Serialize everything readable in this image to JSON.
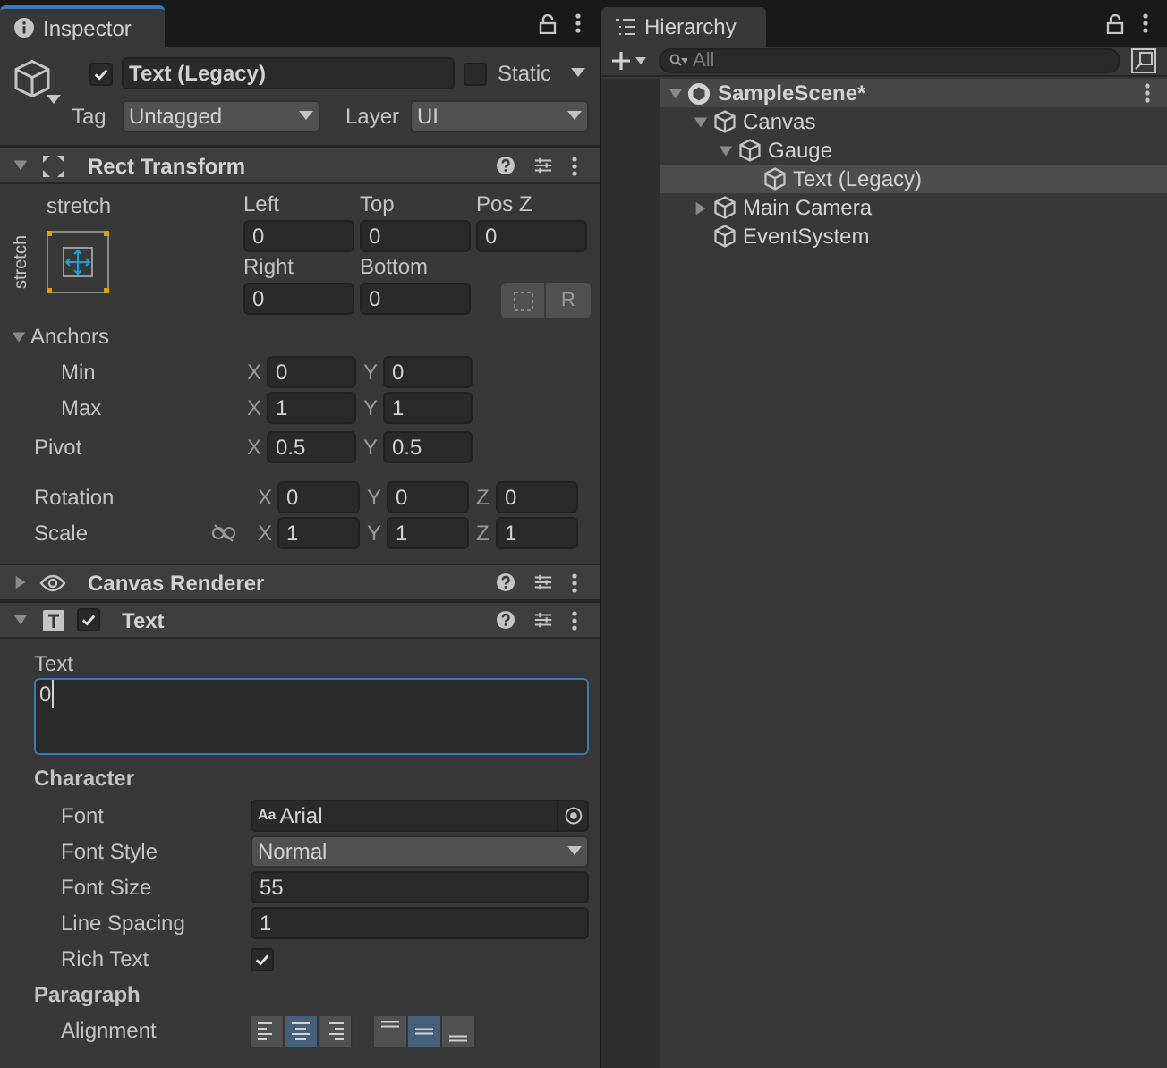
{
  "inspector": {
    "tab": "Inspector",
    "object": {
      "enabled": true,
      "name": "Text (Legacy)",
      "static_label": "Static",
      "static": false,
      "tag_label": "Tag",
      "tag": "Untagged",
      "layer_label": "Layer",
      "layer": "UI"
    },
    "rect_transform": {
      "title": "Rect Transform",
      "expanded": true,
      "anchor_h": "stretch",
      "anchor_v": "stretch",
      "row1": [
        {
          "label": "Left",
          "value": "0"
        },
        {
          "label": "Top",
          "value": "0"
        },
        {
          "label": "Pos Z",
          "value": "0"
        }
      ],
      "row2": [
        {
          "label": "Right",
          "value": "0"
        },
        {
          "label": "Bottom",
          "value": "0"
        }
      ],
      "r_button": "R",
      "anchors": {
        "label": "Anchors",
        "expanded": true,
        "rows": [
          {
            "label": "Min",
            "fields": [
              {
                "axis": "X",
                "value": "0"
              },
              {
                "axis": "Y",
                "value": "0"
              }
            ]
          },
          {
            "label": "Max",
            "fields": [
              {
                "axis": "X",
                "value": "1"
              },
              {
                "axis": "Y",
                "value": "1"
              }
            ]
          }
        ]
      },
      "pivot": {
        "label": "Pivot",
        "fields": [
          {
            "axis": "X",
            "value": "0.5"
          },
          {
            "axis": "Y",
            "value": "0.5"
          }
        ]
      },
      "rotation": {
        "label": "Rotation",
        "fields": [
          {
            "axis": "X",
            "value": "0"
          },
          {
            "axis": "Y",
            "value": "0"
          },
          {
            "axis": "Z",
            "value": "0"
          }
        ]
      },
      "scale": {
        "label": "Scale",
        "fields": [
          {
            "axis": "X",
            "value": "1"
          },
          {
            "axis": "Y",
            "value": "1"
          },
          {
            "axis": "Z",
            "value": "1"
          }
        ]
      }
    },
    "canvas_renderer": {
      "title": "Canvas Renderer",
      "expanded": false
    },
    "text_component": {
      "title": "Text",
      "expanded": true,
      "enabled": true,
      "text_label": "Text",
      "text_value": "0",
      "character": {
        "label": "Character",
        "rows": [
          {
            "kind": "object",
            "label": "Font",
            "value": "Arial",
            "prefix": "Aa"
          },
          {
            "kind": "dropdown",
            "label": "Font Style",
            "value": "Normal"
          },
          {
            "kind": "field",
            "label": "Font Size",
            "value": "55"
          },
          {
            "kind": "field",
            "label": "Line Spacing",
            "value": "1"
          },
          {
            "kind": "checkbox",
            "label": "Rich Text",
            "checked": true
          }
        ]
      },
      "paragraph": {
        "label": "Paragraph",
        "alignment_label": "Alignment",
        "horizontal": [
          {
            "selected": false
          },
          {
            "selected": true
          },
          {
            "selected": false
          }
        ],
        "vertical": [
          {
            "selected": false
          },
          {
            "selected": true
          },
          {
            "selected": false
          }
        ]
      }
    }
  },
  "hierarchy": {
    "tab": "Hierarchy",
    "search": {
      "placeholder": "All"
    },
    "scene": {
      "name": "SampleScene*",
      "expanded": true,
      "children": [
        {
          "name": "Canvas",
          "expanded": true,
          "selected": false,
          "children": [
            {
              "name": "Gauge",
              "expanded": true,
              "selected": false,
              "children": [
                {
                  "name": "Text (Legacy)",
                  "selected": true
                }
              ]
            }
          ]
        },
        {
          "name": "Main Camera",
          "expanded": false,
          "selected": false,
          "has_children": true
        },
        {
          "name": "EventSystem",
          "selected": false
        }
      ]
    }
  }
}
